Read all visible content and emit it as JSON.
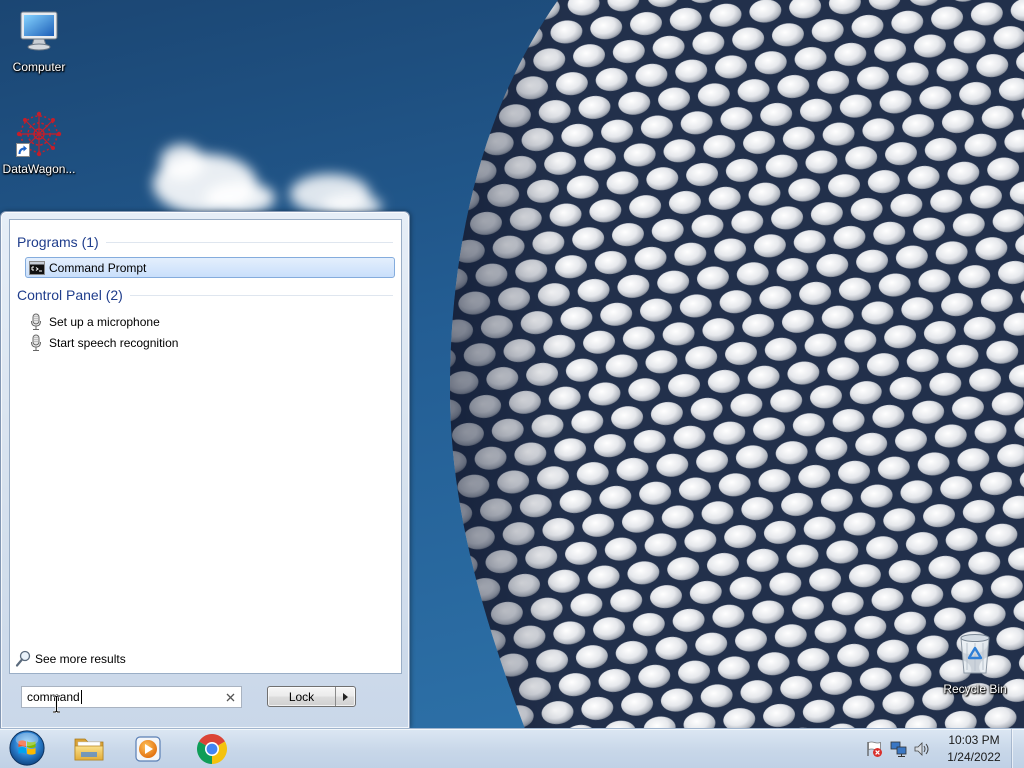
{
  "colors": {
    "heading": "#1f3d8c",
    "selection-top": "#e4effd",
    "selection-bottom": "#c9dffb",
    "selection-border": "#84acdd",
    "taskbar": "#c8d7e9"
  },
  "desktop": {
    "icons": [
      {
        "label": "Computer",
        "icon": "computer-icon"
      },
      {
        "label": "DataWagon...",
        "icon": "datawagon-icon",
        "shortcut_icon": "shortcut-arrow-icon"
      },
      {
        "label": "Recycle Bin",
        "icon": "recycle-bin-icon"
      }
    ]
  },
  "start_menu": {
    "programs": {
      "heading": "Programs (1)",
      "items": [
        {
          "label": "Command Prompt",
          "icon": "command-prompt-icon",
          "selected": true
        }
      ]
    },
    "control_panel": {
      "heading": "Control Panel (2)",
      "items": [
        {
          "label": "Set up a microphone",
          "icon": "microphone-icon"
        },
        {
          "label": "Start speech recognition",
          "icon": "microphone-icon"
        }
      ]
    },
    "see_more": {
      "label": "See more results",
      "icon": "search-icon"
    },
    "search": {
      "value": "command",
      "clear_icon": "clear-icon"
    },
    "power": {
      "label": "Lock",
      "arrow_icon": "chevron-right-icon"
    }
  },
  "taskbar": {
    "start_button": {
      "icon": "windows-orb-icon"
    },
    "pinned": [
      {
        "icon": "file-explorer-icon"
      },
      {
        "icon": "media-player-icon"
      },
      {
        "icon": "chrome-icon"
      }
    ],
    "tray": [
      {
        "icon": "action-center-icon"
      },
      {
        "icon": "network-icon"
      },
      {
        "icon": "volume-icon"
      }
    ],
    "clock": {
      "time": "10:03 PM",
      "date": "1/24/2022"
    }
  }
}
